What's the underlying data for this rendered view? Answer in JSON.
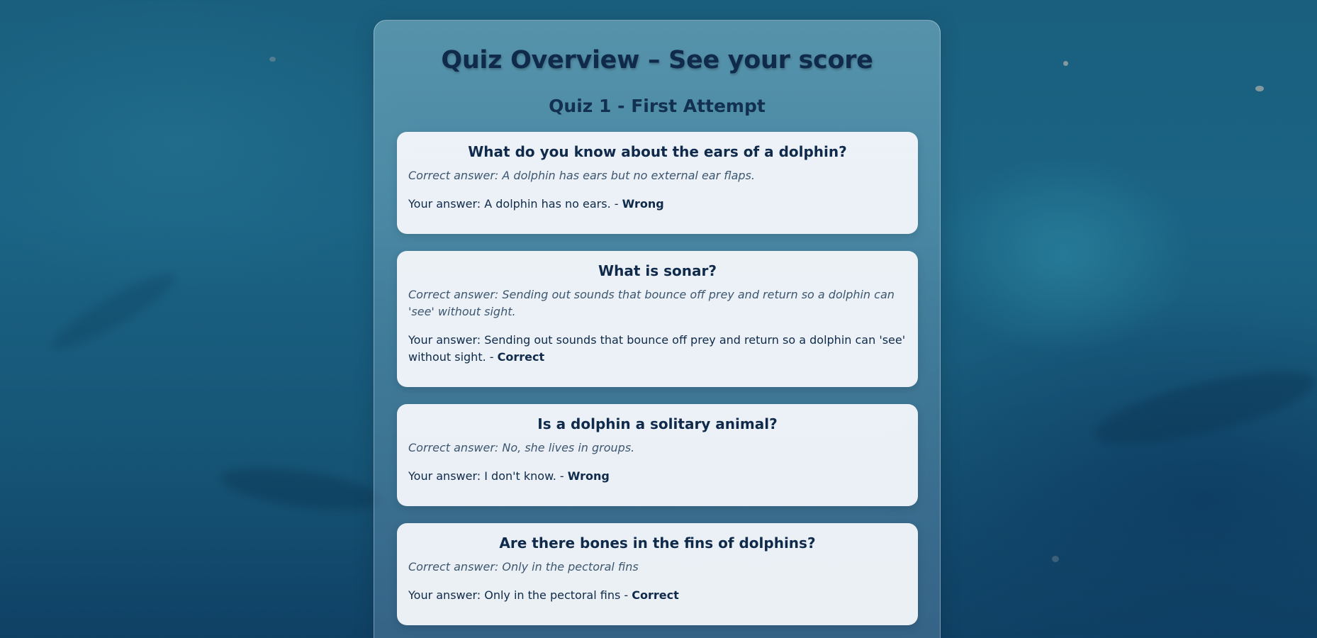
{
  "page": {
    "title": "Quiz Overview – See your score",
    "attempt_title": "Quiz 1 - First Attempt"
  },
  "questions": [
    {
      "question": "What do you know about the ears of a dolphin?",
      "correct_answer": "Correct answer: A dolphin has ears but no external ear flaps.",
      "your_answer": "Your answer: A dolphin has no ears. - ",
      "verdict": "Wrong"
    },
    {
      "question": "What is sonar?",
      "correct_answer": "Correct answer: Sending out sounds that bounce off prey and return so a dolphin can 'see' without sight.",
      "your_answer": "Your answer: Sending out sounds that bounce off prey and return so a dolphin can 'see' without sight. - ",
      "verdict": "Correct"
    },
    {
      "question": "Is a dolphin a solitary animal?",
      "correct_answer": "Correct answer: No, she lives in groups.",
      "your_answer": "Your answer: I don't know. - ",
      "verdict": "Wrong"
    },
    {
      "question": "Are there bones in the fins of dolphins?",
      "correct_answer": "Correct answer: Only in the pectoral fins",
      "your_answer": "Your answer: Only in the pectoral fins - ",
      "verdict": "Correct"
    }
  ]
}
